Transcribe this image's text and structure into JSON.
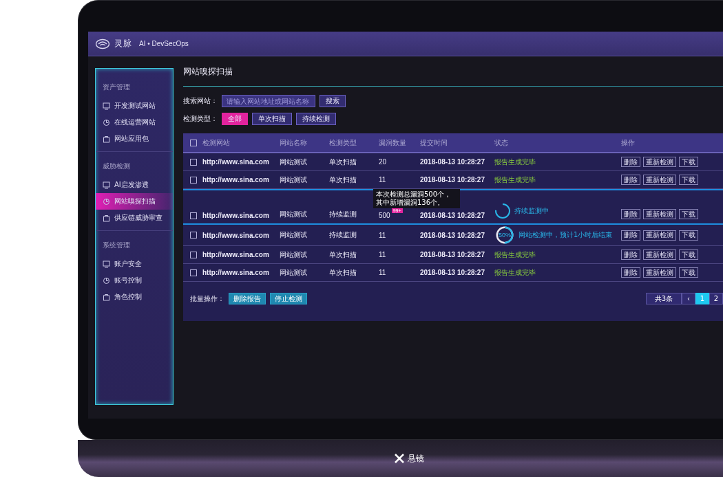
{
  "laptop": {
    "brand": "悬镜"
  },
  "app": {
    "logo": "灵脉",
    "product": "AI • DevSecOps"
  },
  "sidebar": {
    "groups": [
      {
        "title": "资产管理",
        "items": [
          {
            "label": "开发测试网站",
            "selected": false
          },
          {
            "label": "在线运营网站",
            "selected": false
          },
          {
            "label": "网站应用包",
            "selected": false
          }
        ]
      },
      {
        "title": "威胁检测",
        "items": [
          {
            "label": "AI启发渗透",
            "selected": false
          },
          {
            "label": "网站嗅探扫描",
            "selected": true
          },
          {
            "label": "供应链威胁审查",
            "selected": false
          }
        ]
      },
      {
        "title": "系统管理",
        "items": [
          {
            "label": "账户安全",
            "selected": false
          },
          {
            "label": "账号控制",
            "selected": false
          },
          {
            "label": "角色控制",
            "selected": false
          }
        ]
      }
    ]
  },
  "page": {
    "title": "网站嗅探扫描"
  },
  "search": {
    "label": "搜索网站：",
    "placeholder": "请输入网站地址或网站名称",
    "button": "搜索"
  },
  "filter": {
    "label": "检测类型：",
    "options": [
      {
        "label": "全部",
        "selected": true
      },
      {
        "label": "单次扫描",
        "selected": false
      },
      {
        "label": "持续检测",
        "selected": false
      }
    ]
  },
  "table": {
    "header_checked": false,
    "columns": [
      "检测网站",
      "网站名称",
      "检测类型",
      "漏洞数量",
      "提交时间",
      "状态",
      "操作"
    ],
    "rows": [
      {
        "checked": false,
        "url": "http://www.sina.com",
        "name": "网站测试",
        "type": "单次扫描",
        "count": "20",
        "time": "2018-08-13 10:28:27",
        "status": {
          "kind": "done",
          "text": "报告生成完毕"
        },
        "actions": [
          "删除",
          "重新检测",
          "下载"
        ]
      },
      {
        "checked": false,
        "url": "http://www.sina.com",
        "name": "网站测试",
        "type": "单次扫描",
        "count": "11",
        "time": "2018-08-13 10:28:27",
        "status": {
          "kind": "done",
          "text": "报告生成完毕"
        },
        "actions": [
          "删除",
          "重新检测",
          "下载"
        ]
      },
      {
        "checked": false,
        "url": "http://www.sina.com",
        "name": "网站测试",
        "type": "持续监测",
        "count": "500",
        "badge": "99+",
        "tooltip": "本次检测总漏洞500个，其中新增漏洞136个。",
        "time": "2018-08-13 10:28:27",
        "status": {
          "kind": "monitor",
          "text": "持续监测中"
        },
        "actions": [
          "删除",
          "重新检测",
          "下载"
        ]
      },
      {
        "checked": false,
        "url": "http://www.sina.com",
        "name": "网站测试",
        "type": "持续监测",
        "count": "11",
        "time": "2018-08-13 10:28:27",
        "status": {
          "kind": "progress",
          "percent": "50%",
          "text": "网站检测中，预计1小时后结束"
        },
        "actions": [
          "删除",
          "重新检测",
          "下载"
        ]
      },
      {
        "checked": false,
        "url": "http://www.sina.com",
        "name": "网站测试",
        "type": "单次扫描",
        "count": "11",
        "time": "2018-08-13 10:28:27",
        "status": {
          "kind": "done",
          "text": "报告生成完毕"
        },
        "actions": [
          "删除",
          "重新检测",
          "下载"
        ]
      },
      {
        "checked": false,
        "url": "http://www.sina.com",
        "name": "网站测试",
        "type": "单次扫描",
        "count": "11",
        "time": "2018-08-13 10:28:27",
        "status": {
          "kind": "done",
          "text": "报告生成完毕"
        },
        "actions": [
          "删除",
          "重新检测",
          "下载"
        ]
      }
    ]
  },
  "batch": {
    "label": "批量操作：",
    "buttons": [
      "删除报告",
      "停止检测"
    ]
  },
  "pagination": {
    "total": "共3条",
    "prev": "‹",
    "pages": [
      {
        "label": "1",
        "selected": true
      },
      {
        "label": "2",
        "selected": false
      }
    ]
  }
}
